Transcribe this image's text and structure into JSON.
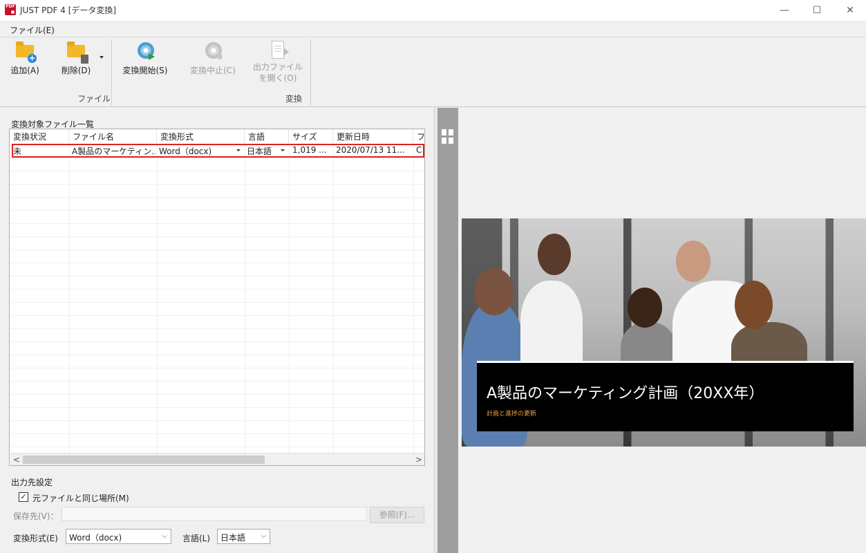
{
  "window": {
    "title": "JUST PDF 4 [データ変換]",
    "logo_text": "PDF",
    "controls": {
      "minimize": "—",
      "maximize": "☐",
      "close": "✕"
    }
  },
  "menu": {
    "file": "ファイル(E)"
  },
  "ribbon": {
    "groups": [
      {
        "label": "ファイル",
        "buttons": [
          {
            "label": "追加(A)",
            "icon": "folder-add-icon",
            "enabled": true
          },
          {
            "label": "削除(D)",
            "icon": "folder-delete-icon",
            "enabled": true
          }
        ]
      },
      {
        "label": "変換",
        "buttons": [
          {
            "label": "変換開始(S)",
            "icon": "convert-start-icon",
            "enabled": true
          },
          {
            "label": "変換中止(C)",
            "icon": "convert-stop-icon",
            "enabled": false
          },
          {
            "label_line1": "出力ファイル",
            "label_line2": "を開く(O)",
            "icon": "open-output-icon",
            "enabled": false
          }
        ]
      }
    ]
  },
  "file_list": {
    "title": "変換対象ファイル一覧",
    "columns": [
      "変換状況",
      "ファイル名",
      "変換形式",
      "言語",
      "サイズ",
      "更新日時",
      "フ"
    ],
    "rows": [
      {
        "status": "未",
        "name": "A製品のマーケティン...",
        "format": "Word（docx)",
        "language": "日本語",
        "size": "1,019 ...",
        "modified": "2020/07/13 11...",
        "extra": "C"
      }
    ],
    "scroll_left": "<",
    "scroll_right": ">"
  },
  "output": {
    "title": "出力先設定",
    "same_location_label": "元ファイルと同じ場所(M)",
    "same_location_checked": true,
    "checkmark": "✓",
    "save_label": "保存先(V)：",
    "save_value": "",
    "browse_label": "参照(F)...",
    "format_label": "変換形式(E)",
    "format_value": "Word（docx)",
    "language_label": "言語(L)",
    "language_value": "日本語",
    "dropdown_arrow": "⌵"
  },
  "preview": {
    "slide_title": "A製品のマーケティング計画（20XX年）",
    "slide_subtitle": "計画と進捗の更新"
  },
  "colors": {
    "selection_border": "#e02020",
    "accent_subtitle": "#f0a040",
    "logo_red": "#c8102e"
  }
}
